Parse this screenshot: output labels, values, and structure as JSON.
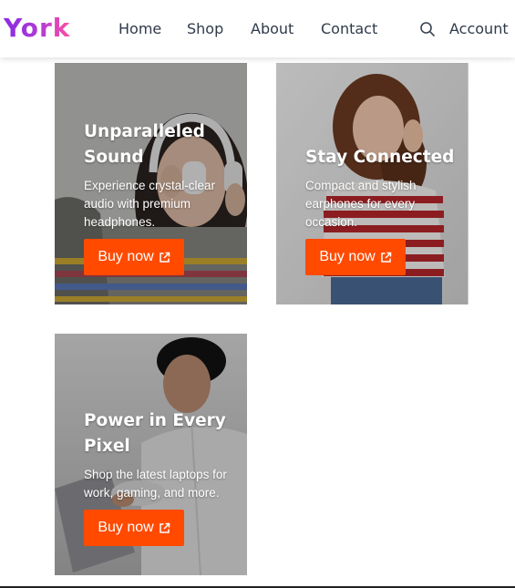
{
  "brand": {
    "name": "York",
    "colors": {
      "from": "#8a2be2",
      "to": "#ff4fa3"
    }
  },
  "nav": {
    "links": [
      "Home",
      "Shop",
      "About",
      "Contact"
    ],
    "search_icon": "search-icon",
    "account_label": "Account"
  },
  "cards": [
    {
      "title": "Unparalleled Sound",
      "description": "Experience crystal-clear audio with premium headphones.",
      "button": "Buy now"
    },
    {
      "title": "Stay Connected",
      "description": "Compact and stylish earphones for every occasion.",
      "button": "Buy now"
    },
    {
      "title": "Power in Every Pixel",
      "description": "Shop the latest laptops for work, gaming, and more.",
      "button": "Buy now"
    }
  ],
  "accent_color": "#ff4a00",
  "button_icon": "external-link-icon"
}
